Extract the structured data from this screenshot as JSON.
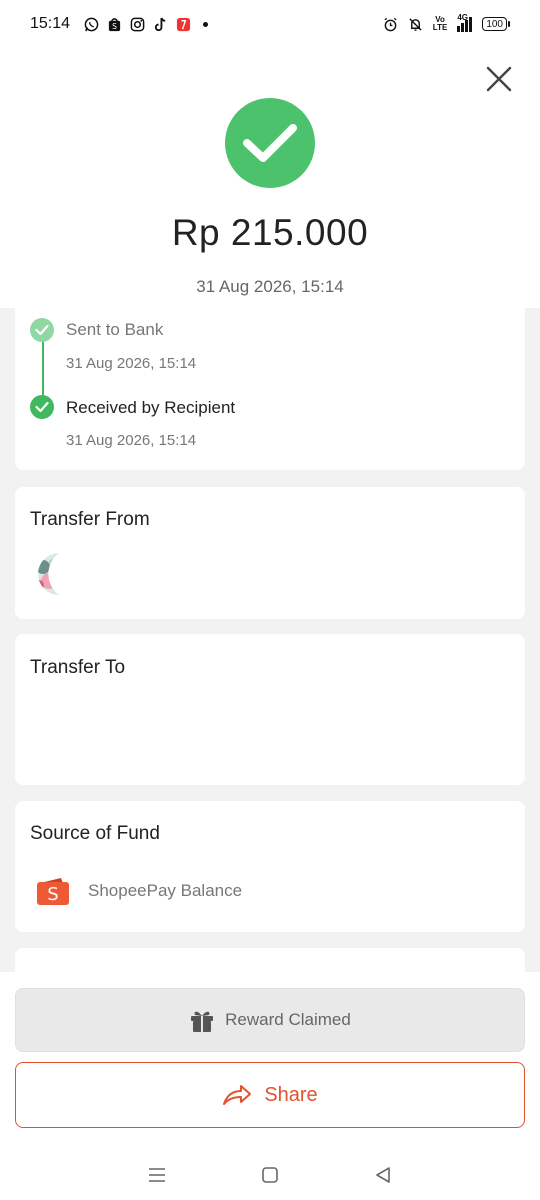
{
  "status_bar": {
    "time": "15:14",
    "battery": "100",
    "network": "4G",
    "lte_top": "Vo",
    "lte_bottom": "LTE"
  },
  "receipt": {
    "amount": "Rp 215.000",
    "datetime": "31 Aug 2026, 15:14"
  },
  "timeline": [
    {
      "label": "Sent to Bank",
      "time": "31 Aug 2026, 15:14"
    },
    {
      "label": "Received by Recipient",
      "time": "31 Aug 2026, 15:14"
    }
  ],
  "transfer_from": {
    "title": "Transfer From"
  },
  "transfer_to": {
    "title": "Transfer To"
  },
  "source_of_fund": {
    "title": "Source of Fund",
    "method": "ShopeePay Balance"
  },
  "actions": {
    "reward_label": "Reward Claimed",
    "share_label": "Share"
  },
  "colors": {
    "success": "#4cc26c",
    "timeline_green": "#3fb85f",
    "shopee_orange": "#e0532e"
  },
  "icons": [
    "whatsapp-icon",
    "shopee-icon",
    "instagram-icon",
    "tiktok-icon",
    "app-icon",
    "alarm-icon",
    "bell-mute-icon",
    "signal-icon",
    "battery-icon",
    "close-icon",
    "check-icon",
    "avatar-image",
    "shopee-wallet-icon",
    "gift-icon",
    "share-arrow-icon",
    "menu-nav-icon",
    "home-nav-icon",
    "back-nav-icon"
  ]
}
